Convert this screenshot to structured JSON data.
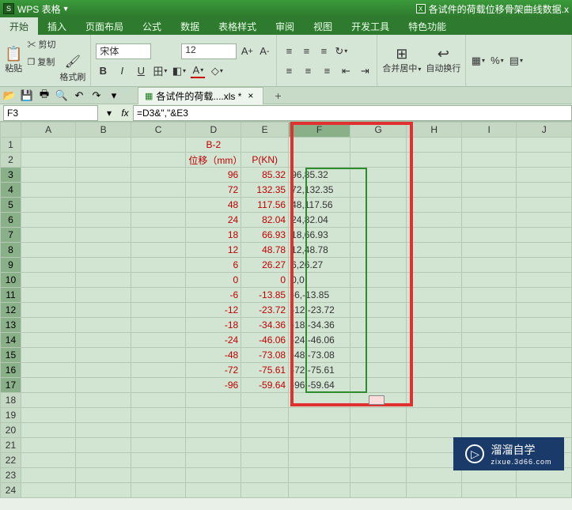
{
  "app": {
    "name": "WPS 表格",
    "doc_title": "各试件的荷载位移骨架曲线数据.x"
  },
  "menu": {
    "items": [
      "开始",
      "插入",
      "页面布局",
      "公式",
      "数据",
      "表格样式",
      "审阅",
      "视图",
      "开发工具",
      "特色功能"
    ],
    "active": 0
  },
  "ribbon": {
    "paste": "粘贴",
    "cut": "剪切",
    "copy": "复制",
    "fmt": "格式刷",
    "font_name": "宋体",
    "font_size": "12",
    "bold": "B",
    "italic": "I",
    "uline": "U",
    "merge": "合并居中",
    "wrap": "自动换行"
  },
  "qat": {
    "tab": "各试件的荷载....xls *"
  },
  "fx": {
    "cell": "F3",
    "formula": "=D3&\",\"&E3"
  },
  "cols": [
    "A",
    "B",
    "C",
    "D",
    "E",
    "F",
    "G",
    "H",
    "I",
    "J"
  ],
  "row1": {
    "title": "B-2"
  },
  "row2": {
    "d": "位移（mm）",
    "e": "P(KN)"
  },
  "datarows": [
    {
      "r": 3,
      "d": "96",
      "e": "85.32",
      "f": "96,85.32"
    },
    {
      "r": 4,
      "d": "72",
      "e": "132.35",
      "f": "72,132.35"
    },
    {
      "r": 5,
      "d": "48",
      "e": "117.56",
      "f": "48,117.56"
    },
    {
      "r": 6,
      "d": "24",
      "e": "82.04",
      "f": "24,82.04"
    },
    {
      "r": 7,
      "d": "18",
      "e": "66.93",
      "f": "18,66.93"
    },
    {
      "r": 8,
      "d": "12",
      "e": "48.78",
      "f": "12,48.78"
    },
    {
      "r": 9,
      "d": "6",
      "e": "26.27",
      "f": "6,26.27"
    },
    {
      "r": 10,
      "d": "0",
      "e": "0",
      "f": "0,0"
    },
    {
      "r": 11,
      "d": "-6",
      "e": "-13.85",
      "f": "-6,-13.85"
    },
    {
      "r": 12,
      "d": "-12",
      "e": "-23.72",
      "f": "-12,-23.72"
    },
    {
      "r": 13,
      "d": "-18",
      "e": "-34.36",
      "f": "-18,-34.36"
    },
    {
      "r": 14,
      "d": "-24",
      "e": "-46.06",
      "f": "-24,-46.06"
    },
    {
      "r": 15,
      "d": "-48",
      "e": "-73.08",
      "f": "-48,-73.08"
    },
    {
      "r": 16,
      "d": "-72",
      "e": "-75.61",
      "f": "-72,-75.61"
    },
    {
      "r": 17,
      "d": "-96",
      "e": "-59.64",
      "f": "-96,-59.64"
    }
  ],
  "emptyrows": [
    18,
    19,
    20,
    21,
    22,
    23,
    24
  ],
  "watermark": {
    "brand": "溜溜自学",
    "sub": "zixue.3d66.com"
  }
}
